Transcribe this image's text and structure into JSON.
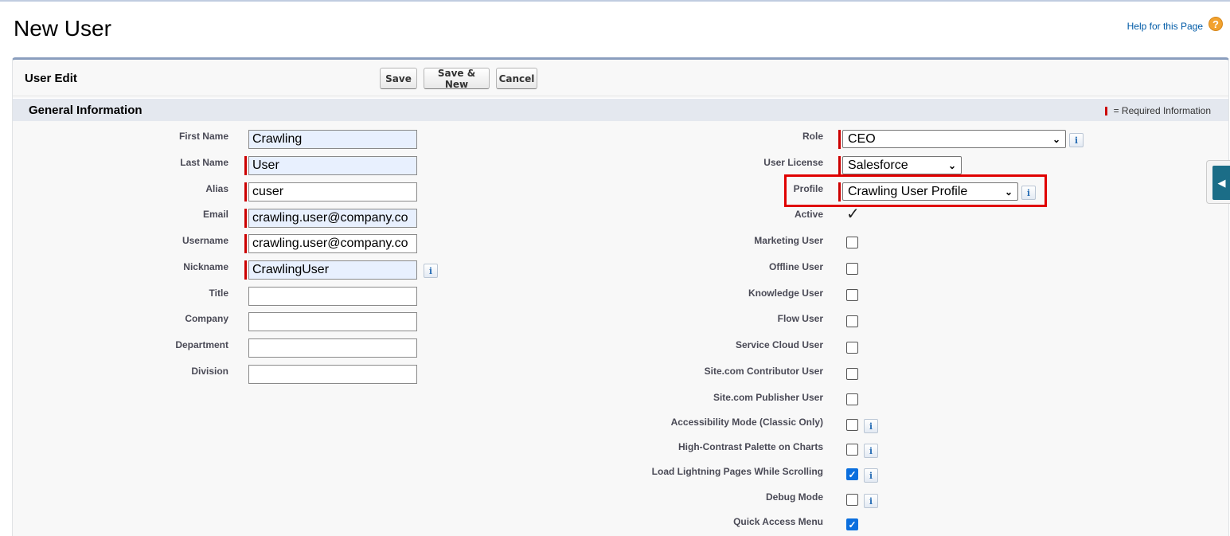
{
  "page": {
    "title": "New User",
    "help_link": "Help for this Page",
    "help_icon": "question-icon"
  },
  "panel": {
    "title": "User Edit",
    "buttons": {
      "save": "Save",
      "save_new": "Save & New",
      "cancel": "Cancel"
    }
  },
  "section": {
    "title": "General Information",
    "required_legend": "= Required Information"
  },
  "left_fields": {
    "first_name": {
      "label": "First Name",
      "value": "Crawling"
    },
    "last_name": {
      "label": "Last Name",
      "value": "User"
    },
    "alias": {
      "label": "Alias",
      "value": "cuser"
    },
    "email": {
      "label": "Email",
      "value": "crawling.user@company.co"
    },
    "username": {
      "label": "Username",
      "value": "crawling.user@company.co"
    },
    "nickname": {
      "label": "Nickname",
      "value": "CrawlingUser"
    },
    "title": {
      "label": "Title",
      "value": ""
    },
    "company": {
      "label": "Company",
      "value": ""
    },
    "department": {
      "label": "Department",
      "value": ""
    },
    "division": {
      "label": "Division",
      "value": ""
    }
  },
  "right_fields": {
    "role": {
      "label": "Role",
      "value": "CEO"
    },
    "user_license": {
      "label": "User License",
      "value": "Salesforce"
    },
    "profile": {
      "label": "Profile",
      "value": "Crawling User Profile"
    },
    "active": {
      "label": "Active",
      "checked": true
    },
    "marketing_user": {
      "label": "Marketing User",
      "checked": false
    },
    "offline_user": {
      "label": "Offline User",
      "checked": false
    },
    "knowledge_user": {
      "label": "Knowledge User",
      "checked": false
    },
    "flow_user": {
      "label": "Flow User",
      "checked": false
    },
    "service_cloud_user": {
      "label": "Service Cloud User",
      "checked": false
    },
    "site_contributor": {
      "label": "Site.com Contributor User",
      "checked": false
    },
    "site_publisher": {
      "label": "Site.com Publisher User",
      "checked": false
    },
    "accessibility_mode": {
      "label": "Accessibility Mode (Classic Only)",
      "checked": false
    },
    "high_contrast": {
      "label": "High-Contrast Palette on Charts",
      "checked": false
    },
    "load_lightning": {
      "label": "Load Lightning Pages While Scrolling",
      "checked": true
    },
    "debug_mode": {
      "label": "Debug Mode",
      "checked": false
    },
    "quick_access": {
      "label": "Quick Access Menu",
      "checked": true
    }
  },
  "glyphs": {
    "info": "i",
    "chevron": "⌄",
    "check": "✓",
    "side_arrow": "◀"
  },
  "colors": {
    "required": "#cc0000",
    "highlight": "#e00000",
    "link": "#015ba7"
  }
}
